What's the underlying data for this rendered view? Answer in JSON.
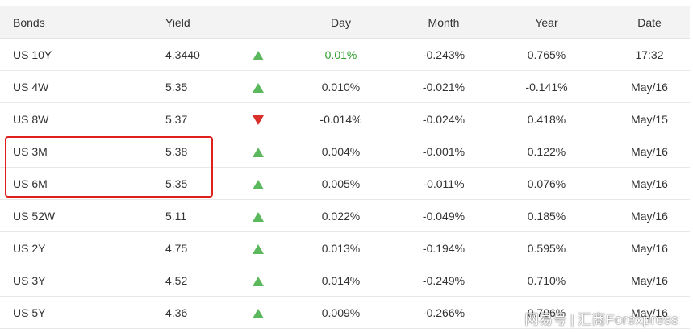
{
  "table": {
    "headers": {
      "bonds": "Bonds",
      "yield": "Yield",
      "day": "Day",
      "month": "Month",
      "year": "Year",
      "date": "Date"
    },
    "rows": [
      {
        "name": "US 10Y",
        "yield": "4.3440",
        "direction": "up",
        "day": "0.01%",
        "day_green": true,
        "month": "-0.243%",
        "year": "0.765%",
        "date": "17:32"
      },
      {
        "name": "US 4W",
        "yield": "5.35",
        "direction": "up",
        "day": "0.010%",
        "month": "-0.021%",
        "year": "-0.141%",
        "date": "May/16"
      },
      {
        "name": "US 8W",
        "yield": "5.37",
        "direction": "down",
        "day": "-0.014%",
        "month": "-0.024%",
        "year": "0.418%",
        "date": "May/15"
      },
      {
        "name": "US 3M",
        "yield": "5.38",
        "direction": "up",
        "day": "0.004%",
        "month": "-0.001%",
        "year": "0.122%",
        "date": "May/16"
      },
      {
        "name": "US 6M",
        "yield": "5.35",
        "direction": "up",
        "day": "0.005%",
        "month": "-0.011%",
        "year": "0.076%",
        "date": "May/16"
      },
      {
        "name": "US 52W",
        "yield": "5.11",
        "direction": "up",
        "day": "0.022%",
        "month": "-0.049%",
        "year": "0.185%",
        "date": "May/16"
      },
      {
        "name": "US 2Y",
        "yield": "4.75",
        "direction": "up",
        "day": "0.013%",
        "month": "-0.194%",
        "year": "0.595%",
        "date": "May/16"
      },
      {
        "name": "US 3Y",
        "yield": "4.52",
        "direction": "up",
        "day": "0.014%",
        "month": "-0.249%",
        "year": "0.710%",
        "date": "May/16"
      },
      {
        "name": "US 5Y",
        "yield": "4.36",
        "direction": "up",
        "day": "0.009%",
        "month": "-0.266%",
        "year": "0.706%",
        "date": "May/16"
      }
    ]
  },
  "icons": {
    "up": "triangle-up-icon",
    "down": "triangle-down-icon"
  },
  "colors": {
    "up": "#5cb85c",
    "down": "#d9302c",
    "highlight": "#e0201c",
    "header_bg": "#f3f3f3"
  },
  "watermark": {
    "left": "网易号",
    "separator": "|",
    "right": "汇商Forexpress"
  }
}
